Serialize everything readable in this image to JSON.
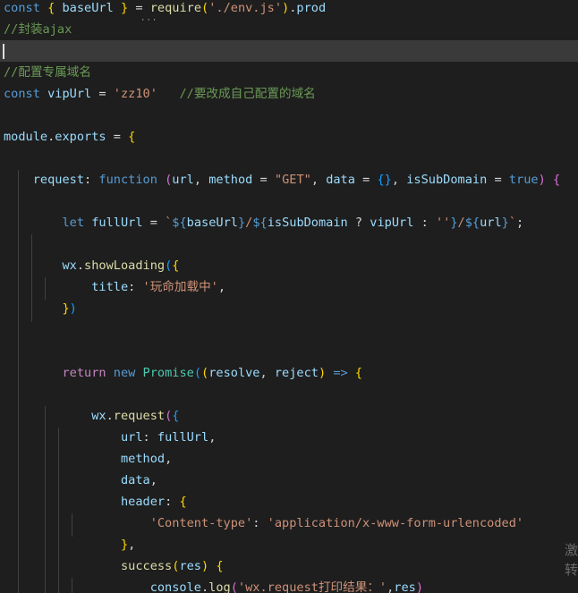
{
  "editor": {
    "language": "javascript",
    "theme": "dark",
    "lines": [
      [
        [
          "kw",
          "const "
        ],
        [
          "brk1",
          "{ "
        ],
        [
          "var",
          "baseUrl "
        ],
        [
          "brk1",
          "}"
        ],
        [
          "pun",
          " = "
        ],
        [
          "fn",
          "require"
        ],
        [
          "brk1",
          "("
        ],
        [
          "str",
          "'./env.js'"
        ],
        [
          "brk1",
          ")"
        ],
        [
          "pun",
          "."
        ],
        [
          "var",
          "prod"
        ]
      ],
      [
        [
          "com",
          "//封装ajax"
        ]
      ],
      [],
      [
        [
          "com",
          "//配置专属域名"
        ]
      ],
      [
        [
          "kw",
          "const "
        ],
        [
          "var",
          "vipUrl"
        ],
        [
          "pun",
          " = "
        ],
        [
          "str",
          "'zz10'"
        ],
        [
          "pun",
          "   "
        ],
        [
          "com",
          "//要改成自己配置的域名"
        ]
      ],
      [],
      [
        [
          "var",
          "module"
        ],
        [
          "pun",
          "."
        ],
        [
          "var",
          "exports"
        ],
        [
          "pun",
          " = "
        ],
        [
          "brk1",
          "{"
        ]
      ],
      [],
      [
        [
          "pun",
          "    "
        ],
        [
          "prop",
          "request"
        ],
        [
          "pun",
          ": "
        ],
        [
          "kw",
          "function "
        ],
        [
          "brk2",
          "("
        ],
        [
          "var",
          "url"
        ],
        [
          "pun",
          ", "
        ],
        [
          "var",
          "method"
        ],
        [
          "pun",
          " = "
        ],
        [
          "str",
          "\"GET\""
        ],
        [
          "pun",
          ", "
        ],
        [
          "var",
          "data"
        ],
        [
          "pun",
          " = "
        ],
        [
          "brk3",
          "{}"
        ],
        [
          "pun",
          ", "
        ],
        [
          "var",
          "isSubDomain"
        ],
        [
          "pun",
          " = "
        ],
        [
          "bool",
          "true"
        ],
        [
          "brk2",
          ")"
        ],
        [
          "pun",
          " "
        ],
        [
          "brk2",
          "{"
        ]
      ],
      [],
      [
        [
          "pun",
          "        "
        ],
        [
          "kw",
          "let "
        ],
        [
          "var",
          "fullUrl"
        ],
        [
          "pun",
          " = "
        ],
        [
          "str",
          "`"
        ],
        [
          "kw",
          "${"
        ],
        [
          "var",
          "baseUrl"
        ],
        [
          "kw",
          "}"
        ],
        [
          "str",
          "/"
        ],
        [
          "kw",
          "${"
        ],
        [
          "var",
          "isSubDomain"
        ],
        [
          "pun",
          " ? "
        ],
        [
          "var",
          "vipUrl"
        ],
        [
          "pun",
          " : "
        ],
        [
          "str",
          "''"
        ],
        [
          "kw",
          "}"
        ],
        [
          "str",
          "/"
        ],
        [
          "kw",
          "${"
        ],
        [
          "var",
          "url"
        ],
        [
          "kw",
          "}"
        ],
        [
          "str",
          "`"
        ],
        [
          "pun",
          ";"
        ]
      ],
      [],
      [
        [
          "pun",
          "        "
        ],
        [
          "var",
          "wx"
        ],
        [
          "pun",
          "."
        ],
        [
          "fn",
          "showLoading"
        ],
        [
          "brk3",
          "("
        ],
        [
          "brk1",
          "{"
        ]
      ],
      [
        [
          "pun",
          "            "
        ],
        [
          "prop",
          "title"
        ],
        [
          "pun",
          ": "
        ],
        [
          "str",
          "'玩命加载中'"
        ],
        [
          "pun",
          ","
        ]
      ],
      [
        [
          "pun",
          "        "
        ],
        [
          "brk1",
          "}"
        ],
        [
          "brk3",
          ")"
        ]
      ],
      [],
      [],
      [
        [
          "pun",
          "        "
        ],
        [
          "ctl",
          "return "
        ],
        [
          "kw",
          "new "
        ],
        [
          "cls",
          "Promise"
        ],
        [
          "brk3",
          "("
        ],
        [
          "brk1",
          "("
        ],
        [
          "var",
          "resolve"
        ],
        [
          "pun",
          ", "
        ],
        [
          "var",
          "reject"
        ],
        [
          "brk1",
          ")"
        ],
        [
          "pun",
          " "
        ],
        [
          "kw",
          "=>"
        ],
        [
          "pun",
          " "
        ],
        [
          "brk1",
          "{"
        ]
      ],
      [],
      [
        [
          "pun",
          "            "
        ],
        [
          "var",
          "wx"
        ],
        [
          "pun",
          "."
        ],
        [
          "fn",
          "request"
        ],
        [
          "brk2",
          "("
        ],
        [
          "brk3",
          "{"
        ]
      ],
      [
        [
          "pun",
          "                "
        ],
        [
          "prop",
          "url"
        ],
        [
          "pun",
          ": "
        ],
        [
          "var",
          "fullUrl"
        ],
        [
          "pun",
          ","
        ]
      ],
      [
        [
          "pun",
          "                "
        ],
        [
          "var",
          "method"
        ],
        [
          "pun",
          ","
        ]
      ],
      [
        [
          "pun",
          "                "
        ],
        [
          "var",
          "data"
        ],
        [
          "pun",
          ","
        ]
      ],
      [
        [
          "pun",
          "                "
        ],
        [
          "prop",
          "header"
        ],
        [
          "pun",
          ": "
        ],
        [
          "brk1",
          "{"
        ]
      ],
      [
        [
          "pun",
          "                    "
        ],
        [
          "key",
          "'Content-type'"
        ],
        [
          "pun",
          ": "
        ],
        [
          "str",
          "'application/x-www-form-urlencoded'"
        ]
      ],
      [
        [
          "pun",
          "                "
        ],
        [
          "brk1",
          "}"
        ],
        [
          "pun",
          ","
        ]
      ],
      [
        [
          "pun",
          "                "
        ],
        [
          "fn",
          "success"
        ],
        [
          "brk1",
          "("
        ],
        [
          "var",
          "res"
        ],
        [
          "brk1",
          ")"
        ],
        [
          "pun",
          " "
        ],
        [
          "brk1",
          "{"
        ]
      ],
      [
        [
          "pun",
          "                    "
        ],
        [
          "var",
          "console"
        ],
        [
          "pun",
          "."
        ],
        [
          "fn",
          "log"
        ],
        [
          "brk2",
          "("
        ],
        [
          "str",
          "'wx.request打印结果：'"
        ],
        [
          "pun",
          ","
        ],
        [
          "var",
          "res"
        ],
        [
          "brk2",
          ")"
        ]
      ]
    ]
  },
  "watermark": {
    "chars": [
      "激",
      "转"
    ]
  }
}
